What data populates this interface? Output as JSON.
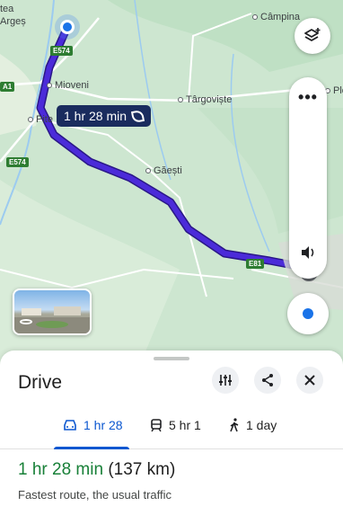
{
  "map": {
    "places": {
      "arges": "Argeș",
      "arges_prefix": "tea",
      "campina": "Câmpina",
      "mioveni": "Mioveni",
      "targoviste": "Târgoviște",
      "pitesti": "Pite",
      "gaesti": "Găești",
      "ploiesti": "Plo"
    },
    "roads": {
      "e574_top": "E574",
      "e574_left": "E574",
      "e81": "E81",
      "a1": "A1"
    },
    "route_label": "1 hr 28 min",
    "route_color": "#4b2bd9",
    "more_options": "•••"
  },
  "sheet": {
    "title": "Drive",
    "tabs": [
      {
        "label": "1 hr 28",
        "icon": "car-icon"
      },
      {
        "label": "5 hr 1",
        "icon": "train-icon"
      },
      {
        "label": "1 day",
        "icon": "walk-icon"
      }
    ],
    "summary_time": "1 hr 28 min",
    "summary_distance": " (137 km)",
    "description": "Fastest route, the usual traffic"
  },
  "colors": {
    "accent": "#0b57d0",
    "good_time": "#188038",
    "route_label_bg": "#1a2c5e"
  }
}
